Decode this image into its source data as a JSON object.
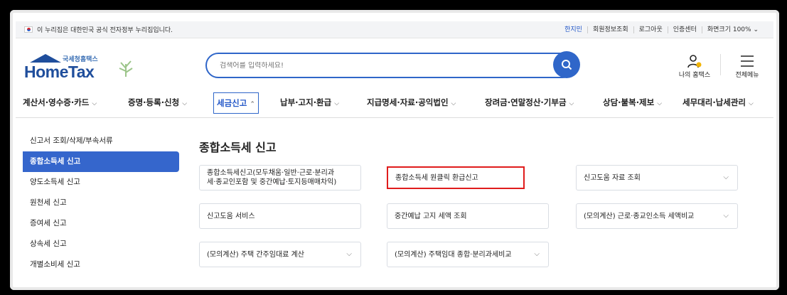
{
  "govbar": {
    "notice": "이 누리집은 대한민국 공식 전자정부 누리집입니다.",
    "links": [
      "한지민",
      "회원정보조회",
      "로그아웃",
      "인증센터",
      "화면크기 100% ⌄"
    ]
  },
  "header": {
    "logo_sub": "국세청홈택스",
    "logo_main": "HomeTax",
    "search_placeholder": "검색어를 입력하세요!",
    "my_home": "나의 홈택스",
    "all_menu": "전체메뉴"
  },
  "gnb": {
    "items": [
      "계산서·영수증·카드",
      "증명·등록·신청",
      "세금신고",
      "납부·고지·환급",
      "지급명세·자료·공익법인",
      "장려금·연말정산·기부금",
      "상담·불복·제보",
      "세무대리·납세관리"
    ],
    "active_index": 2
  },
  "sidebar": {
    "items": [
      "신고서 조회/삭제/부속서류",
      "종합소득세 신고",
      "양도소득세 신고",
      "원천세 신고",
      "증여세 신고",
      "상속세 신고",
      "개별소비세 신고"
    ],
    "active_index": 1
  },
  "main": {
    "title": "종합소득세 신고",
    "cards": [
      {
        "line1": "종합소득세신고(모두채움·일반·근로·분리과",
        "line2": "세·종교인포함 및 중간예납·토지등매매차익)"
      },
      {
        "line1": "종합소득세 원클릭 환급신고",
        "line2": ""
      },
      {
        "line1": "신고도움 자료 조회",
        "line2": ""
      },
      {
        "line1": "신고도움 서비스",
        "line2": ""
      },
      {
        "line1": "중간예납 고지 세액 조회",
        "line2": ""
      },
      {
        "line1": "(모의계산) 근로·종교인소득 세액비교",
        "line2": ""
      },
      {
        "line1": "(모의계산) 주택 간주임대료 계산",
        "line2": ""
      },
      {
        "line1": "(모의계산) 주택임대 종합·분리과세비교",
        "line2": ""
      }
    ]
  },
  "colors": {
    "accent": "#2f66c9",
    "highlight": "#e01c1c"
  }
}
